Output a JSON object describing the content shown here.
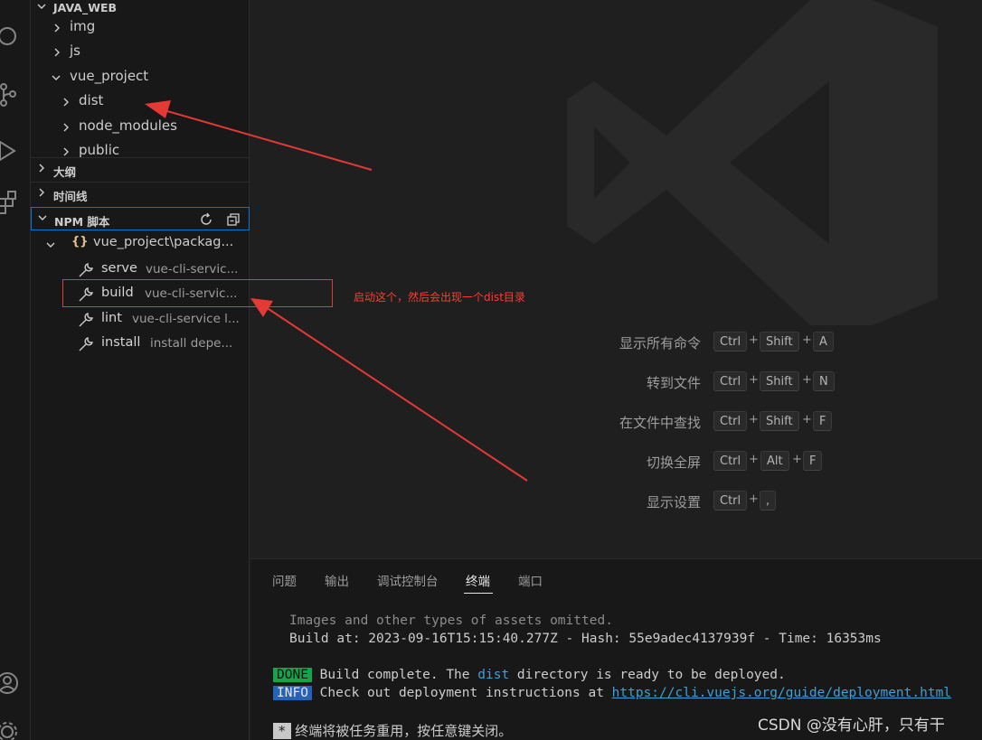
{
  "explorer": {
    "root": "JAVA_WEB",
    "items": [
      "img",
      "js",
      "vue_project",
      "dist",
      "node_modules",
      "public"
    ]
  },
  "sections": {
    "outline": "大纲",
    "timeline": "时间线",
    "npm": "NPM 脚本"
  },
  "npm": {
    "package": "vue_project\\packag...",
    "scripts": [
      {
        "name": "serve",
        "cmd": "vue-cli-servic..."
      },
      {
        "name": "build",
        "cmd": "vue-cli-servic..."
      },
      {
        "name": "lint",
        "cmd": "vue-cli-service l..."
      },
      {
        "name": "install",
        "cmd": "install depe..."
      }
    ]
  },
  "annotation": {
    "text": "启动这个，然后会出现一个dist目录"
  },
  "shortcuts": [
    {
      "label": "显示所有命令",
      "keys": [
        "Ctrl",
        "Shift",
        "A"
      ]
    },
    {
      "label": "转到文件",
      "keys": [
        "Ctrl",
        "Shift",
        "N"
      ]
    },
    {
      "label": "在文件中查找",
      "keys": [
        "Ctrl",
        "Shift",
        "F"
      ]
    },
    {
      "label": "切换全屏",
      "keys": [
        "Ctrl",
        "Alt",
        "F"
      ]
    },
    {
      "label": "显示设置",
      "keys": [
        "Ctrl",
        ","
      ]
    }
  ],
  "panel": {
    "tabs": [
      "问题",
      "输出",
      "调试控制台",
      "终端",
      "端口"
    ],
    "active_tab": "终端"
  },
  "terminal": {
    "line1": "Images and other types of assets omitted.",
    "line2": "Build at: 2023-09-16T15:15:40.277Z - Hash: 55e9adec4137939f - Time: 16353ms",
    "done_badge": "DONE",
    "done_pre": " Build complete. The ",
    "done_word": "dist",
    "done_post": " directory is ready to be deployed.",
    "info_badge": "INFO",
    "info_pre": " Check out deployment instructions at ",
    "info_link": "https://cli.vuejs.org/guide/deployment.html",
    "star_badge": "*",
    "reuse": "终端将被任务重用，按任意键关闭。"
  },
  "watermark": "CSDN @没有心肝，只有干",
  "colors": {
    "accent": "#0078d4",
    "annotation_red": "#e53935",
    "done_green": "#16a34a",
    "info_blue": "#2563b8"
  }
}
